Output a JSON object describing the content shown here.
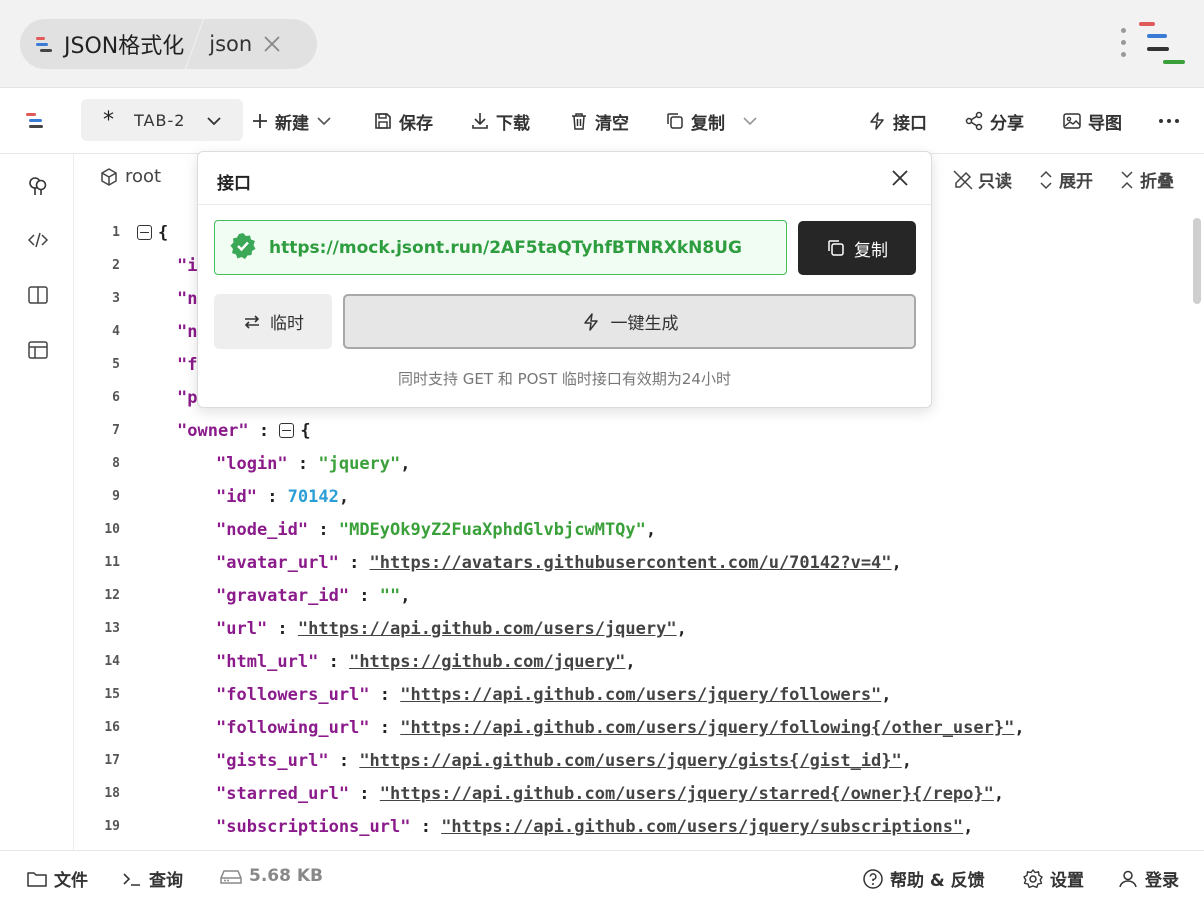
{
  "titlebar": {
    "app_name": "JSON格式化",
    "format_tag": "json"
  },
  "toolbar": {
    "tab_label": "TAB-2",
    "new_label": "新建",
    "save_label": "保存",
    "download_label": "下载",
    "clear_label": "清空",
    "copy_label": "复制",
    "api_label": "接口",
    "share_label": "分享",
    "export_image_label": "导图"
  },
  "editor": {
    "root_label": "root",
    "readonly_label": "只读",
    "expand_label": "展开",
    "collapse_label": "折叠",
    "lines": [
      {
        "num": "1"
      },
      {
        "num": "2"
      },
      {
        "num": "3"
      },
      {
        "num": "4"
      },
      {
        "num": "5"
      },
      {
        "num": "6"
      },
      {
        "num": "7",
        "key": "\"owner\"",
        "sep": " : ",
        "open": "{"
      },
      {
        "num": "8",
        "key": "\"login\"",
        "sep": " : ",
        "value": "\"jquery\"",
        "type": "s",
        "tail": ","
      },
      {
        "num": "9",
        "key": "\"id\"",
        "sep": " : ",
        "value": "70142",
        "type": "n",
        "tail": ","
      },
      {
        "num": "10",
        "key": "\"node_id\"",
        "sep": " : ",
        "value": "\"MDEyOk9yZ2FuaXphdGlvbjcwMTQy\"",
        "type": "s",
        "tail": ","
      },
      {
        "num": "11",
        "key": "\"avatar_url\"",
        "sep": " : ",
        "value": "\"https://avatars.githubusercontent.com/u/70142?v=4\"",
        "type": "u",
        "tail": ","
      },
      {
        "num": "12",
        "key": "\"gravatar_id\"",
        "sep": " : ",
        "value": "\"\"",
        "type": "s",
        "tail": ","
      },
      {
        "num": "13",
        "key": "\"url\"",
        "sep": " : ",
        "value": "\"https://api.github.com/users/jquery\"",
        "type": "u",
        "tail": ","
      },
      {
        "num": "14",
        "key": "\"html_url\"",
        "sep": " : ",
        "value": "\"https://github.com/jquery\"",
        "type": "u",
        "tail": ","
      },
      {
        "num": "15",
        "key": "\"followers_url\"",
        "sep": " : ",
        "value": "\"https://api.github.com/users/jquery/followers\"",
        "type": "u",
        "tail": ","
      },
      {
        "num": "16",
        "key": "\"following_url\"",
        "sep": " : ",
        "value": "\"https://api.github.com/users/jquery/following{/other_user}\"",
        "type": "u",
        "tail": ","
      },
      {
        "num": "17",
        "key": "\"gists_url\"",
        "sep": " : ",
        "value": "\"https://api.github.com/users/jquery/gists{/gist_id}\"",
        "type": "u",
        "tail": ","
      },
      {
        "num": "18",
        "key": "\"starred_url\"",
        "sep": " : ",
        "value": "\"https://api.github.com/users/jquery/starred{/owner}{/repo}\"",
        "type": "u",
        "tail": ","
      },
      {
        "num": "19",
        "key": "\"subscriptions_url\"",
        "sep": " : ",
        "value": "\"https://api.github.com/users/jquery/subscriptions\"",
        "type": "u",
        "tail": ","
      }
    ],
    "partial_keys": [
      "\"i",
      "\"n",
      "\"n",
      "\"f",
      "\"p"
    ]
  },
  "api_popup": {
    "title": "接口",
    "url": "https://mock.jsont.run/2AF5taQTyhfBTNRXkN8UG",
    "copy_label": "复制",
    "temp_label": "临时",
    "generate_label": "一键生成",
    "hint": "同时支持 GET 和 POST 临时接口有效期为24小时"
  },
  "footer": {
    "file_label": "文件",
    "query_label": "查询",
    "size": "5.68 KB",
    "help_label": "帮助 & 反馈",
    "settings_label": "设置",
    "login_label": "登录"
  },
  "colors": {
    "accent_red": "#e05a5a",
    "accent_blue": "#3a7bd5",
    "accent_green": "#3aa03a",
    "key_purple": "#8b1a8b",
    "number_blue": "#2a9fd6"
  }
}
